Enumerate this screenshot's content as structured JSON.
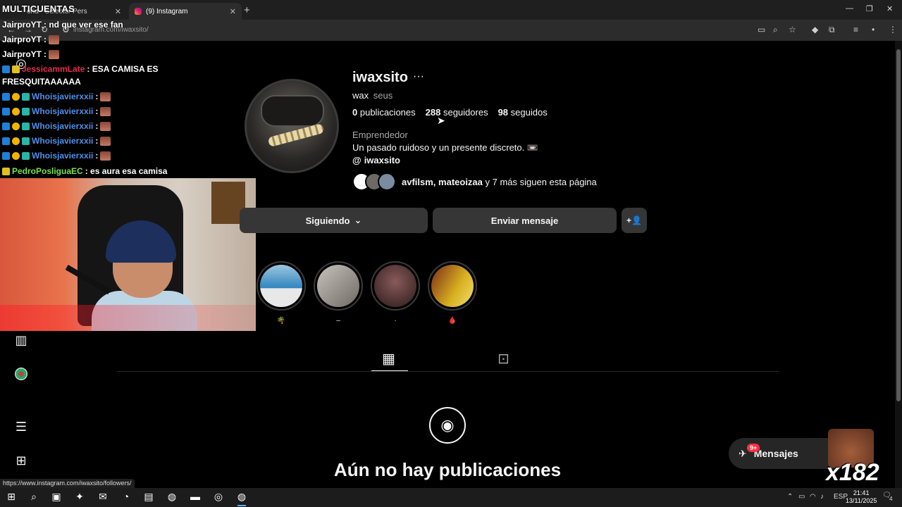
{
  "browser": {
    "tabs": [
      {
        "label": "oria - Selector Pers"
      },
      {
        "label": "(9) Instagram"
      }
    ],
    "new_tab": "+",
    "url": "instagram.com/iwaxsito/",
    "status_url": "https://www.instagram.com/iwaxsito/followers/"
  },
  "overlay": {
    "title": "MULTICUENTAS",
    "chat": [
      {
        "user": "JairproYT",
        "msg": " : nd que ver ese fan",
        "color": "white"
      },
      {
        "user": "JairproYT",
        "msg": " : ",
        "color": "white"
      },
      {
        "user": "JairproYT",
        "msg": " : ",
        "color": "white"
      },
      {
        "user": "JessicammLate",
        "msg": " : ESA CAMISA ES",
        "color": "red"
      },
      {
        "user": "",
        "msg": "FRESQUITAAAAAA",
        "color": "white"
      },
      {
        "user": "Whoisjavierxxii",
        "msg": " : ",
        "color": "blue"
      },
      {
        "user": "Whoisjavierxxii",
        "msg": " : ",
        "color": "blue"
      },
      {
        "user": "Whoisjavierxxii",
        "msg": " : ",
        "color": "blue"
      },
      {
        "user": "Whoisjavierxxii",
        "msg": " : ",
        "color": "blue"
      },
      {
        "user": "Whoisjavierxxii",
        "msg": " : ",
        "color": "blue"
      },
      {
        "user": "PedroPosliguaEC",
        "msg": " : es aura esa camisa",
        "color": "green"
      }
    ],
    "counter": "x182"
  },
  "profile": {
    "username": "iwaxsito",
    "more_icon": "···",
    "full_name": "wax",
    "pronouns": "seus",
    "stats": {
      "posts_count": "0",
      "posts_label": "publicaciones",
      "followers_count": "288",
      "followers_label": "seguidores",
      "following_count": "98",
      "following_label": "seguidos"
    },
    "category": "Emprendedor",
    "bio": "Un pasado ruidoso y un presente discreto. 📼",
    "threads_handle": "iwaxsito",
    "followed_by": {
      "names": "avfilsm, mateoizaa",
      "rest": " y 7 más siguen esta página"
    },
    "buttons": {
      "following": "Siguiendo",
      "message": "Enviar mensaje"
    },
    "highlights": [
      {
        "label": "🌴",
        "color": "#4a9fd0"
      },
      {
        "label": "–",
        "color": "#8a8580"
      },
      {
        "label": "·",
        "color": "#6a4a4a"
      },
      {
        "label": "🩸",
        "color": "#c7a020"
      }
    ],
    "empty_title": "Aún no hay publicaciones"
  },
  "messages": {
    "label": "Mensajes",
    "badge": "9+"
  },
  "taskbar": {
    "lang": "ESP",
    "time": "21:41",
    "date": "13/11/2025",
    "notif": "4"
  }
}
